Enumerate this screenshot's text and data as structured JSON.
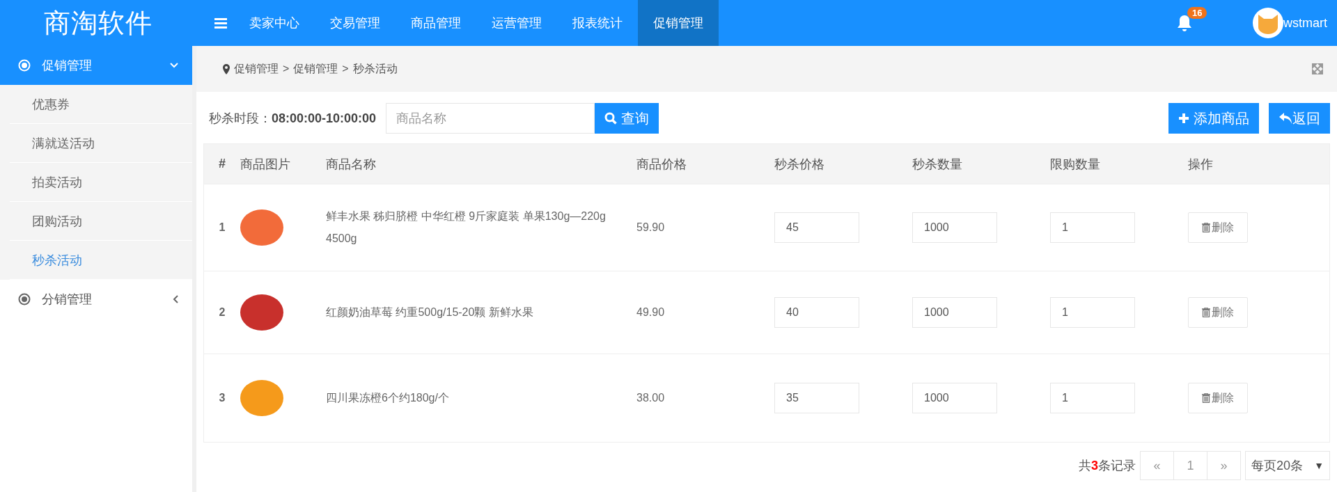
{
  "brand": "商淘软件",
  "nav": [
    {
      "label": "卖家中心",
      "selected": false
    },
    {
      "label": "交易管理",
      "selected": false
    },
    {
      "label": "商品管理",
      "selected": false
    },
    {
      "label": "运营管理",
      "selected": false
    },
    {
      "label": "报表统计",
      "selected": false
    },
    {
      "label": "促销管理",
      "selected": true
    }
  ],
  "notifications": {
    "count": "16"
  },
  "user": {
    "name": "wstmart"
  },
  "sidebar": {
    "groups": [
      {
        "label": "促销管理",
        "expanded": true,
        "children": [
          {
            "label": "优惠券",
            "selected": false
          },
          {
            "label": "满就送活动",
            "selected": false
          },
          {
            "label": "拍卖活动",
            "selected": false
          },
          {
            "label": "团购活动",
            "selected": false
          },
          {
            "label": "秒杀活动",
            "selected": true
          }
        ]
      },
      {
        "label": "分销管理",
        "expanded": false
      }
    ]
  },
  "breadcrumb": [
    "促销管理",
    "促销管理",
    "秒杀活动"
  ],
  "breadcrumb_separator": ">",
  "toolbar": {
    "period": "秒杀时段：**08:00:00-10:00:00**",
    "search": {
      "placeholder": "商品名称"
    },
    "search_button": "查询",
    "add_button": "添加商品",
    "back_button": "返回"
  },
  "table": {
    "columns": [
      "#",
      "商品图片",
      "商品名称",
      "商品价格",
      "秒杀价格",
      "秒杀数量",
      "限购数量",
      "操作"
    ],
    "rows": [
      {
        "index": "1",
        "name": "鲜丰水果 秭归脐橙 中华红橙 9斤家庭装 单果130g—220g 4500g",
        "price": "59.90",
        "seckill_price": "45",
        "seckill_qty": "1000",
        "limit_qty": "1",
        "action": "删除",
        "color": "#f26b3a"
      },
      {
        "index": "2",
        "name": "红颜奶油草莓 约重500g/15-20颗 新鲜水果",
        "price": "49.90",
        "seckill_price": "40",
        "seckill_qty": "1000",
        "limit_qty": "1",
        "action": "删除",
        "color": "#c8302c"
      },
      {
        "index": "3",
        "name": "四川果冻橙6个约180g/个",
        "price": "38.00",
        "seckill_price": "35",
        "seckill_qty": "1000",
        "limit_qty": "1",
        "action": "删除",
        "color": "#f59a1b"
      }
    ]
  },
  "pager": {
    "total": "共**3**条记录",
    "prev": "«",
    "page": "1",
    "next": "»",
    "page_size": "每页20条",
    "page_size_caret": "▼"
  }
}
